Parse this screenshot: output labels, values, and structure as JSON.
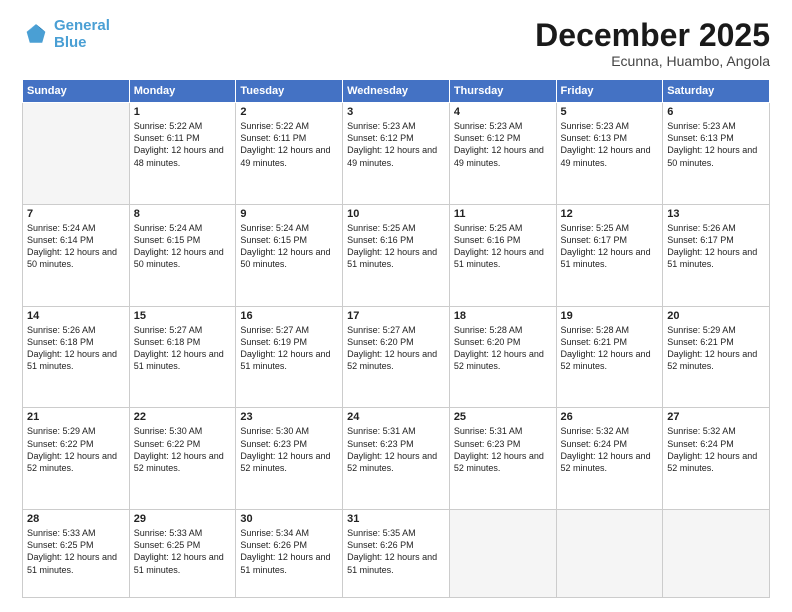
{
  "header": {
    "logo_line1": "General",
    "logo_line2": "Blue",
    "month": "December 2025",
    "location": "Ecunna, Huambo, Angola"
  },
  "weekdays": [
    "Sunday",
    "Monday",
    "Tuesday",
    "Wednesday",
    "Thursday",
    "Friday",
    "Saturday"
  ],
  "weeks": [
    [
      {
        "day": "",
        "sunrise": "",
        "sunset": "",
        "daylight": "",
        "empty": true
      },
      {
        "day": "1",
        "sunrise": "Sunrise: 5:22 AM",
        "sunset": "Sunset: 6:11 PM",
        "daylight": "Daylight: 12 hours and 48 minutes."
      },
      {
        "day": "2",
        "sunrise": "Sunrise: 5:22 AM",
        "sunset": "Sunset: 6:11 PM",
        "daylight": "Daylight: 12 hours and 49 minutes."
      },
      {
        "day": "3",
        "sunrise": "Sunrise: 5:23 AM",
        "sunset": "Sunset: 6:12 PM",
        "daylight": "Daylight: 12 hours and 49 minutes."
      },
      {
        "day": "4",
        "sunrise": "Sunrise: 5:23 AM",
        "sunset": "Sunset: 6:12 PM",
        "daylight": "Daylight: 12 hours and 49 minutes."
      },
      {
        "day": "5",
        "sunrise": "Sunrise: 5:23 AM",
        "sunset": "Sunset: 6:13 PM",
        "daylight": "Daylight: 12 hours and 49 minutes."
      },
      {
        "day": "6",
        "sunrise": "Sunrise: 5:23 AM",
        "sunset": "Sunset: 6:13 PM",
        "daylight": "Daylight: 12 hours and 50 minutes."
      }
    ],
    [
      {
        "day": "7",
        "sunrise": "Sunrise: 5:24 AM",
        "sunset": "Sunset: 6:14 PM",
        "daylight": "Daylight: 12 hours and 50 minutes."
      },
      {
        "day": "8",
        "sunrise": "Sunrise: 5:24 AM",
        "sunset": "Sunset: 6:15 PM",
        "daylight": "Daylight: 12 hours and 50 minutes."
      },
      {
        "day": "9",
        "sunrise": "Sunrise: 5:24 AM",
        "sunset": "Sunset: 6:15 PM",
        "daylight": "Daylight: 12 hours and 50 minutes."
      },
      {
        "day": "10",
        "sunrise": "Sunrise: 5:25 AM",
        "sunset": "Sunset: 6:16 PM",
        "daylight": "Daylight: 12 hours and 51 minutes."
      },
      {
        "day": "11",
        "sunrise": "Sunrise: 5:25 AM",
        "sunset": "Sunset: 6:16 PM",
        "daylight": "Daylight: 12 hours and 51 minutes."
      },
      {
        "day": "12",
        "sunrise": "Sunrise: 5:25 AM",
        "sunset": "Sunset: 6:17 PM",
        "daylight": "Daylight: 12 hours and 51 minutes."
      },
      {
        "day": "13",
        "sunrise": "Sunrise: 5:26 AM",
        "sunset": "Sunset: 6:17 PM",
        "daylight": "Daylight: 12 hours and 51 minutes."
      }
    ],
    [
      {
        "day": "14",
        "sunrise": "Sunrise: 5:26 AM",
        "sunset": "Sunset: 6:18 PM",
        "daylight": "Daylight: 12 hours and 51 minutes."
      },
      {
        "day": "15",
        "sunrise": "Sunrise: 5:27 AM",
        "sunset": "Sunset: 6:18 PM",
        "daylight": "Daylight: 12 hours and 51 minutes."
      },
      {
        "day": "16",
        "sunrise": "Sunrise: 5:27 AM",
        "sunset": "Sunset: 6:19 PM",
        "daylight": "Daylight: 12 hours and 51 minutes."
      },
      {
        "day": "17",
        "sunrise": "Sunrise: 5:27 AM",
        "sunset": "Sunset: 6:20 PM",
        "daylight": "Daylight: 12 hours and 52 minutes."
      },
      {
        "day": "18",
        "sunrise": "Sunrise: 5:28 AM",
        "sunset": "Sunset: 6:20 PM",
        "daylight": "Daylight: 12 hours and 52 minutes."
      },
      {
        "day": "19",
        "sunrise": "Sunrise: 5:28 AM",
        "sunset": "Sunset: 6:21 PM",
        "daylight": "Daylight: 12 hours and 52 minutes."
      },
      {
        "day": "20",
        "sunrise": "Sunrise: 5:29 AM",
        "sunset": "Sunset: 6:21 PM",
        "daylight": "Daylight: 12 hours and 52 minutes."
      }
    ],
    [
      {
        "day": "21",
        "sunrise": "Sunrise: 5:29 AM",
        "sunset": "Sunset: 6:22 PM",
        "daylight": "Daylight: 12 hours and 52 minutes."
      },
      {
        "day": "22",
        "sunrise": "Sunrise: 5:30 AM",
        "sunset": "Sunset: 6:22 PM",
        "daylight": "Daylight: 12 hours and 52 minutes."
      },
      {
        "day": "23",
        "sunrise": "Sunrise: 5:30 AM",
        "sunset": "Sunset: 6:23 PM",
        "daylight": "Daylight: 12 hours and 52 minutes."
      },
      {
        "day": "24",
        "sunrise": "Sunrise: 5:31 AM",
        "sunset": "Sunset: 6:23 PM",
        "daylight": "Daylight: 12 hours and 52 minutes."
      },
      {
        "day": "25",
        "sunrise": "Sunrise: 5:31 AM",
        "sunset": "Sunset: 6:23 PM",
        "daylight": "Daylight: 12 hours and 52 minutes."
      },
      {
        "day": "26",
        "sunrise": "Sunrise: 5:32 AM",
        "sunset": "Sunset: 6:24 PM",
        "daylight": "Daylight: 12 hours and 52 minutes."
      },
      {
        "day": "27",
        "sunrise": "Sunrise: 5:32 AM",
        "sunset": "Sunset: 6:24 PM",
        "daylight": "Daylight: 12 hours and 52 minutes."
      }
    ],
    [
      {
        "day": "28",
        "sunrise": "Sunrise: 5:33 AM",
        "sunset": "Sunset: 6:25 PM",
        "daylight": "Daylight: 12 hours and 51 minutes."
      },
      {
        "day": "29",
        "sunrise": "Sunrise: 5:33 AM",
        "sunset": "Sunset: 6:25 PM",
        "daylight": "Daylight: 12 hours and 51 minutes."
      },
      {
        "day": "30",
        "sunrise": "Sunrise: 5:34 AM",
        "sunset": "Sunset: 6:26 PM",
        "daylight": "Daylight: 12 hours and 51 minutes."
      },
      {
        "day": "31",
        "sunrise": "Sunrise: 5:35 AM",
        "sunset": "Sunset: 6:26 PM",
        "daylight": "Daylight: 12 hours and 51 minutes."
      },
      {
        "day": "",
        "sunrise": "",
        "sunset": "",
        "daylight": "",
        "empty": true
      },
      {
        "day": "",
        "sunrise": "",
        "sunset": "",
        "daylight": "",
        "empty": true
      },
      {
        "day": "",
        "sunrise": "",
        "sunset": "",
        "daylight": "",
        "empty": true
      }
    ]
  ]
}
